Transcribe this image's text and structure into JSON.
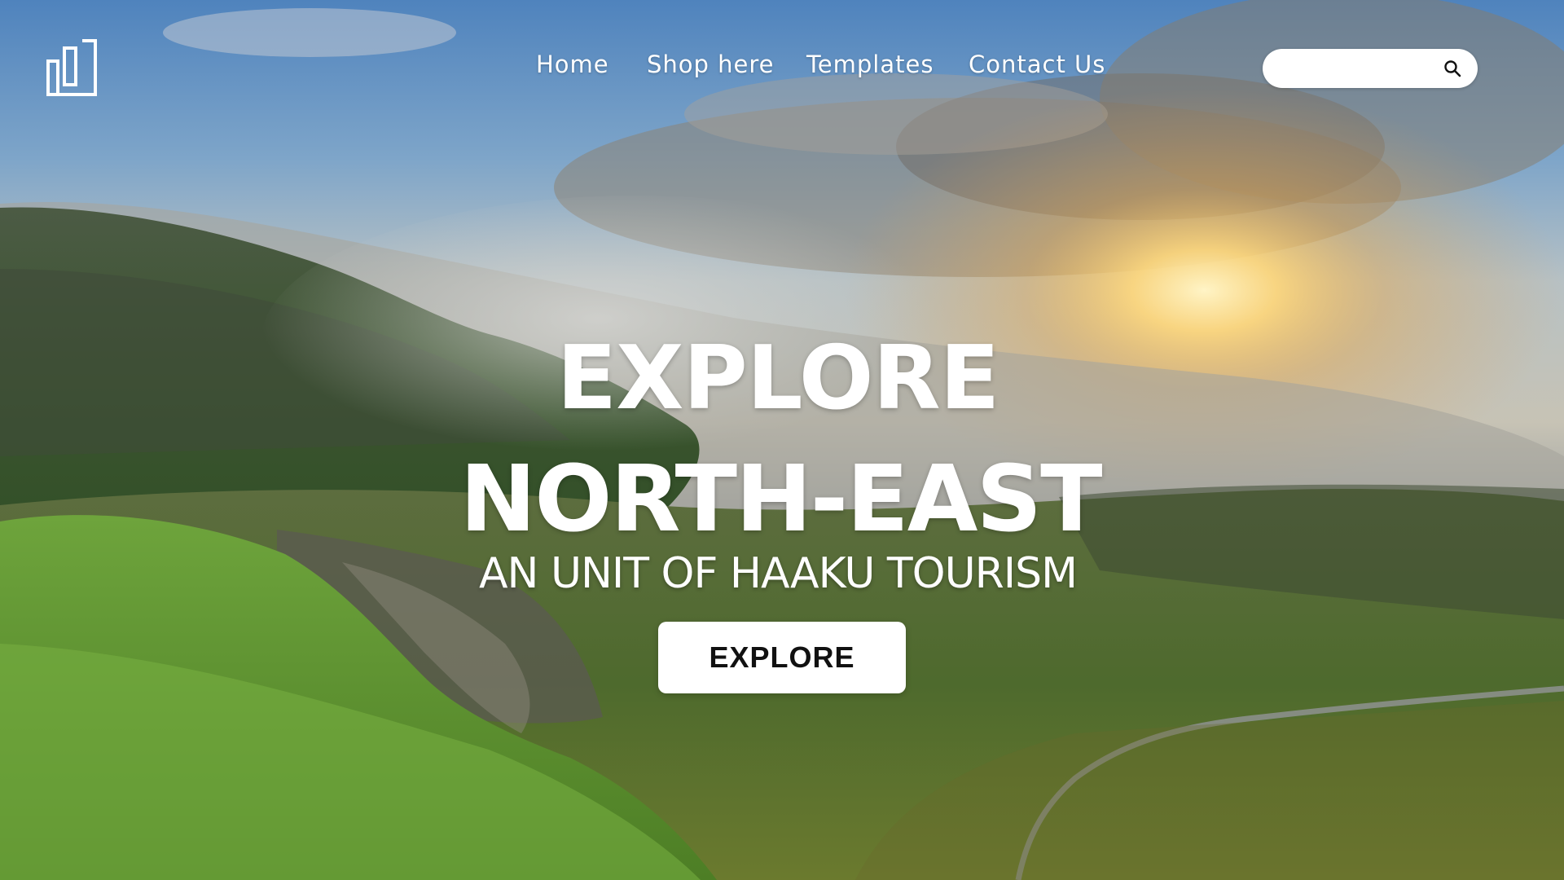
{
  "nav": {
    "items": [
      {
        "label": "Home"
      },
      {
        "label": "Shop here"
      },
      {
        "label": "Templates"
      },
      {
        "label": "Contact Us"
      }
    ]
  },
  "search": {
    "placeholder": "",
    "icon": "search-icon"
  },
  "logo": {
    "icon": "building-logo-icon"
  },
  "hero": {
    "headline_line1": "EXPLORE",
    "headline_line2": "NORTH-EAST",
    "subtitle": "AN UNIT OF HAAKU TOURISM",
    "cta_label": "EXPLORE"
  },
  "colors": {
    "text": "#ffffff",
    "button_bg": "#ffffff",
    "button_text": "#111111",
    "search_bg": "#ffffff"
  }
}
